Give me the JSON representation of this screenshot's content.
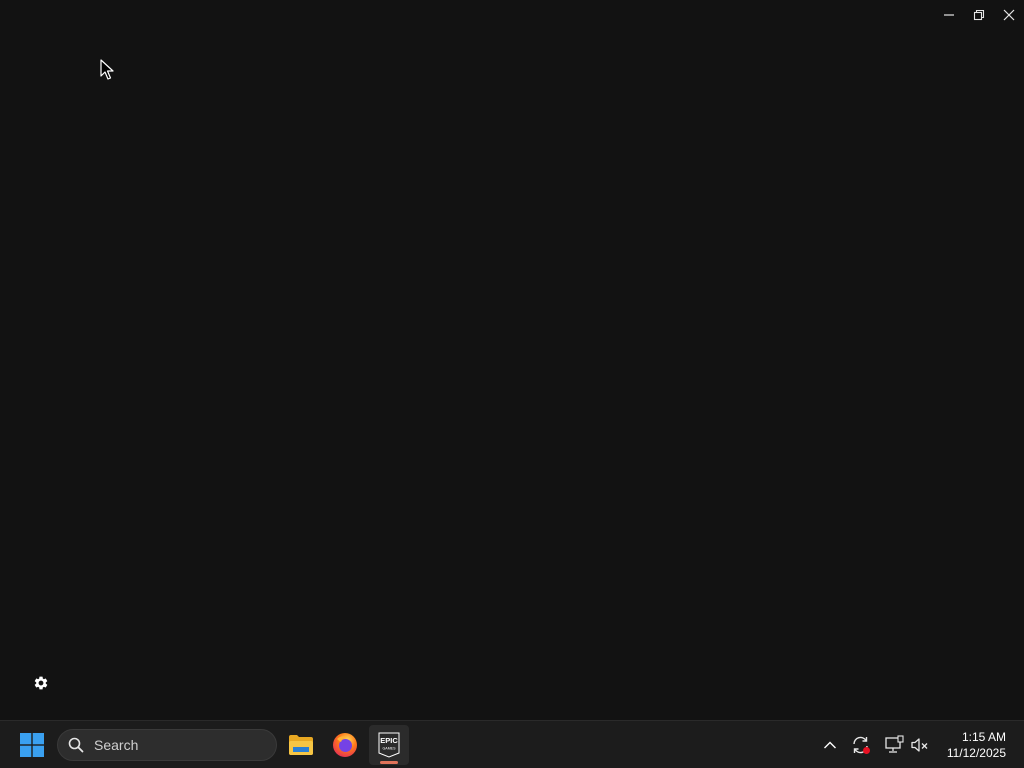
{
  "window": {
    "controls": {
      "minimize": "minimize",
      "restore": "restore",
      "close": "close"
    }
  },
  "taskbar": {
    "search_placeholder": "Search",
    "pinned": [
      {
        "name": "file-explorer-icon"
      },
      {
        "name": "firefox-icon"
      },
      {
        "name": "epic-games-launcher-icon",
        "active": true
      }
    ],
    "epic_logo_text": "EPIC",
    "epic_logo_sub": "GAMES",
    "clock": {
      "time": "1:15 AM",
      "date": "11/12/2025"
    }
  },
  "colors": {
    "app_background": "#121212",
    "taskbar_background": "#1c1c1c",
    "active_indicator": "#e0735a",
    "windows_blue": "#3aa0f0",
    "notification_red": "#e81123"
  }
}
